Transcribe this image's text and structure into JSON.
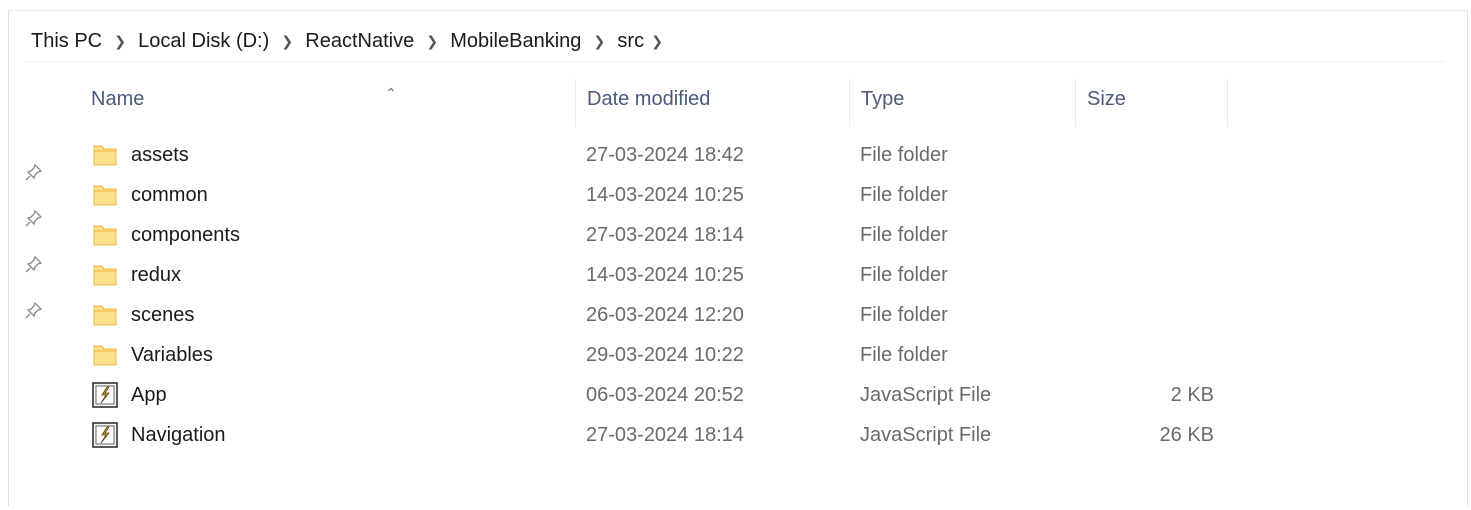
{
  "breadcrumb": {
    "items": [
      "This PC",
      "Local Disk (D:)",
      "ReactNative",
      "MobileBanking",
      "src"
    ]
  },
  "columns": {
    "name": "Name",
    "date_modified": "Date modified",
    "type": "Type",
    "size": "Size"
  },
  "files": [
    {
      "name": "assets",
      "date": "27-03-2024 18:42",
      "type": "File folder",
      "size": "",
      "icon": "folder-icon"
    },
    {
      "name": "common",
      "date": "14-03-2024 10:25",
      "type": "File folder",
      "size": "",
      "icon": "folder-icon"
    },
    {
      "name": "components",
      "date": "27-03-2024 18:14",
      "type": "File folder",
      "size": "",
      "icon": "folder-icon"
    },
    {
      "name": "redux",
      "date": "14-03-2024 10:25",
      "type": "File folder",
      "size": "",
      "icon": "folder-icon"
    },
    {
      "name": "scenes",
      "date": "26-03-2024 12:20",
      "type": "File folder",
      "size": "",
      "icon": "folder-icon"
    },
    {
      "name": "Variables",
      "date": "29-03-2024 10:22",
      "type": "File folder",
      "size": "",
      "icon": "folder-icon"
    },
    {
      "name": "App",
      "date": "06-03-2024 20:52",
      "type": "JavaScript File",
      "size": "2 KB",
      "icon": "javascript-file-icon"
    },
    {
      "name": "Navigation",
      "date": "27-03-2024 18:14",
      "type": "JavaScript File",
      "size": "26 KB",
      "icon": "javascript-file-icon"
    }
  ],
  "pinned_count": 4,
  "colors": {
    "folder_fill": "#FFE08A",
    "folder_edge": "#E8B84A",
    "header_text": "#4a5a7a",
    "secondary_text": "#6a6a6a"
  }
}
